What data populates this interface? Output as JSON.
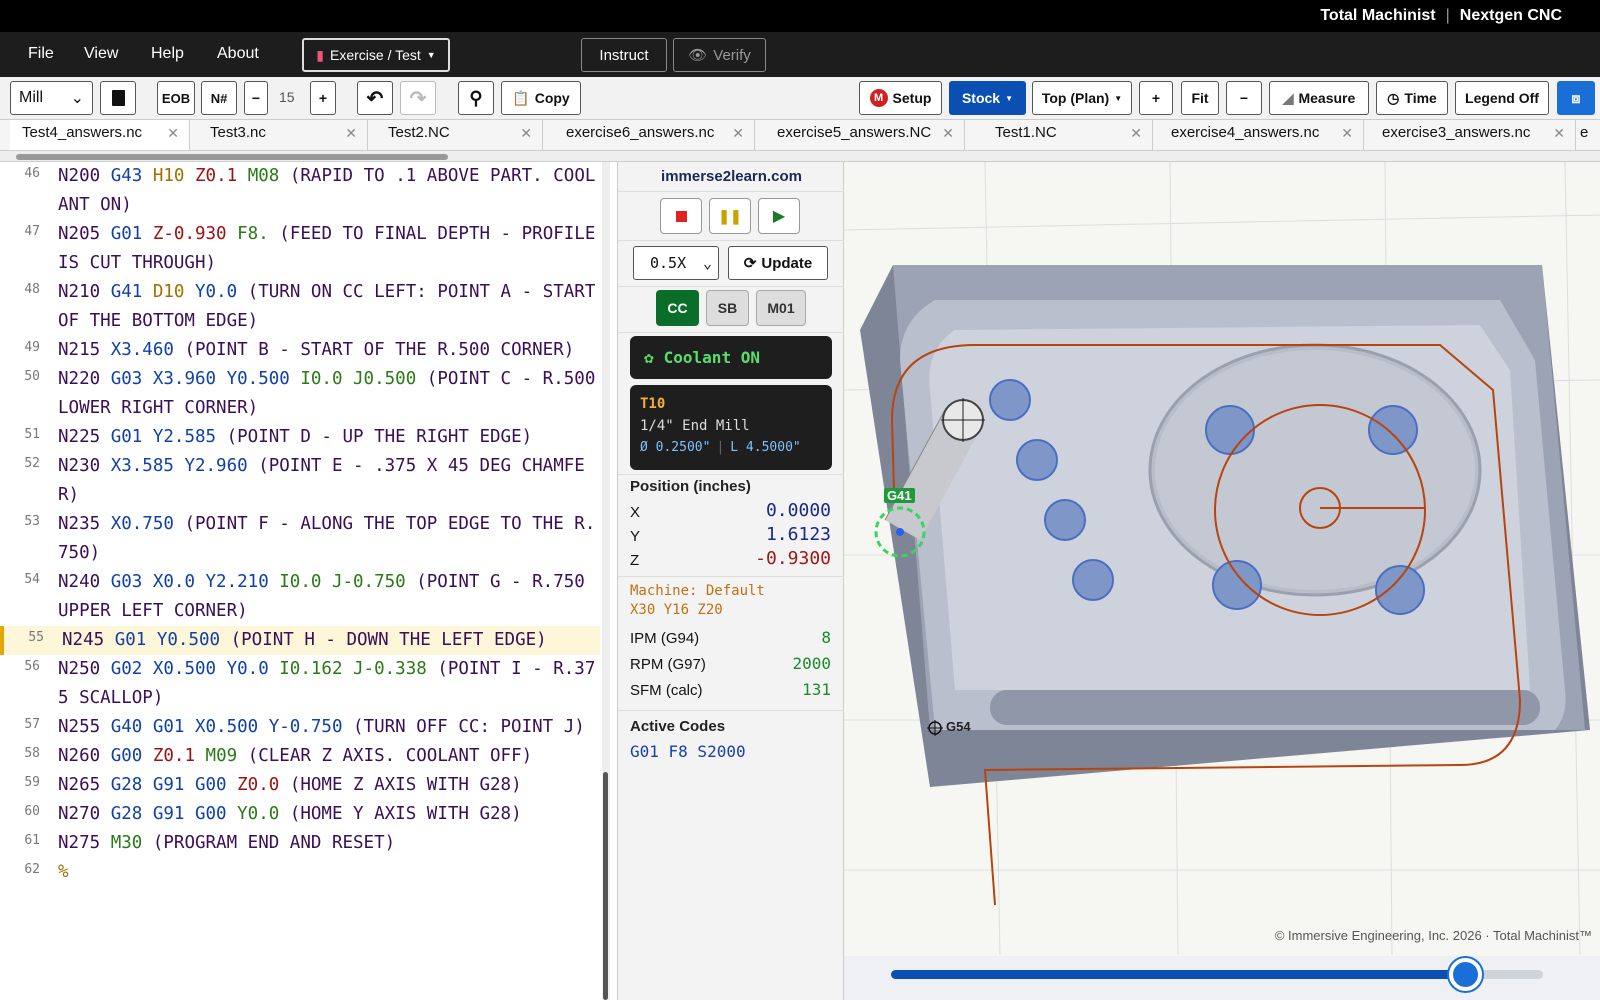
{
  "brand": {
    "left": "Total Machinist",
    "right": "Nextgen CNC"
  },
  "menu": {
    "file": "File",
    "view": "View",
    "help": "Help",
    "about": "About",
    "exercise": "Exercise / Test",
    "instruct": "Instruct",
    "verify": "Verify"
  },
  "toolbar": {
    "machine_type": "Mill",
    "eob": "EOB",
    "ncount": "N#",
    "minus": "−",
    "step": "15",
    "plus": "+",
    "copy": "Copy",
    "setup": "Setup",
    "stock": "Stock",
    "view": "Top (Plan)",
    "zoom_in": "+",
    "fit": "Fit",
    "zoom_out": "−",
    "measure": "Measure",
    "time": "Time",
    "legend": "Legend Off"
  },
  "tabs": [
    "Test4_answers.nc",
    "Test3.nc",
    "Test2.NC",
    "exercise6_answers.nc",
    "exercise5_answers.NC",
    "Test1.NC",
    "exercise4_answers.nc",
    "exercise3_answers.nc",
    "e"
  ],
  "code_lines": [
    {
      "n": "46",
      "segs": [
        [
          "n",
          "N200 "
        ],
        [
          "g",
          "G43 "
        ],
        [
          "t",
          "H10 "
        ],
        [
          "z",
          "Z0.1 "
        ],
        [
          "m",
          "M08 "
        ],
        [
          "n",
          "(RAPID TO .1 ABOVE PART. COOLANT ON)"
        ]
      ]
    },
    {
      "n": "47",
      "segs": [
        [
          "n",
          "N205 "
        ],
        [
          "g",
          "G01 "
        ],
        [
          "z",
          "Z-0.930 "
        ],
        [
          "m",
          "F8. "
        ],
        [
          "n",
          "(FEED TO FINAL DEPTH - PROFILE IS CUT THROUGH)"
        ]
      ]
    },
    {
      "n": "48",
      "segs": [
        [
          "n",
          "N210 "
        ],
        [
          "g",
          "G41 "
        ],
        [
          "t",
          "D10 "
        ],
        [
          "g",
          "Y0.0 "
        ],
        [
          "n",
          "(TURN ON CC LEFT: POINT A - START OF THE BOTTOM EDGE)"
        ]
      ]
    },
    {
      "n": "49",
      "segs": [
        [
          "n",
          "N215 "
        ],
        [
          "g",
          "X3.460 "
        ],
        [
          "n",
          "(POINT B - START OF THE R.500 CORNER)"
        ]
      ]
    },
    {
      "n": "50",
      "segs": [
        [
          "n",
          "N220 "
        ],
        [
          "g",
          "G03 X3.960 Y0.500 "
        ],
        [
          "m",
          "I0.0 J0.500 "
        ],
        [
          "n",
          "(POINT C - R.500 LOWER RIGHT CORNER)"
        ]
      ]
    },
    {
      "n": "51",
      "segs": [
        [
          "n",
          "N225 "
        ],
        [
          "g",
          "G01 Y2.585 "
        ],
        [
          "n",
          "(POINT D - UP THE RIGHT EDGE)"
        ]
      ]
    },
    {
      "n": "52",
      "segs": [
        [
          "n",
          "N230 "
        ],
        [
          "g",
          "X3.585 Y2.960 "
        ],
        [
          "n",
          "(POINT E - .375 X 45 DEG CHAMFER)"
        ]
      ]
    },
    {
      "n": "53",
      "segs": [
        [
          "n",
          "N235 "
        ],
        [
          "g",
          "X0.750 "
        ],
        [
          "n",
          "(POINT F - ALONG THE TOP EDGE TO THE R.750)"
        ]
      ]
    },
    {
      "n": "54",
      "segs": [
        [
          "n",
          "N240 "
        ],
        [
          "g",
          "G03 X0.0 Y2.210 "
        ],
        [
          "m",
          "I0.0 J-0.750 "
        ],
        [
          "n",
          "(POINT G - R.750 UPPER LEFT CORNER)"
        ]
      ]
    },
    {
      "n": "55",
      "segs": [
        [
          "n",
          "N245 "
        ],
        [
          "g",
          "G01 Y0.500 "
        ],
        [
          "n",
          "(POINT H - DOWN THE LEFT EDGE)"
        ]
      ]
    },
    {
      "n": "56",
      "segs": [
        [
          "n",
          "N250 "
        ],
        [
          "g",
          "G02 X0.500 Y0.0 "
        ],
        [
          "m",
          "I0.162 J-0.338 "
        ],
        [
          "n",
          "(POINT I - R.375 SCALLOP)"
        ]
      ]
    },
    {
      "n": "57",
      "segs": [
        [
          "n",
          "N255 "
        ],
        [
          "g",
          "G40 G01 X0.500 Y-0.750 "
        ],
        [
          "n",
          "(TURN OFF CC: POINT J)"
        ]
      ]
    },
    {
      "n": "58",
      "segs": [
        [
          "n",
          "N260 "
        ],
        [
          "g",
          "G00 "
        ],
        [
          "z",
          "Z0.1 "
        ],
        [
          "m",
          "M09 "
        ],
        [
          "n",
          "(CLEAR Z AXIS. COOLANT OFF)"
        ]
      ]
    },
    {
      "n": "59",
      "segs": [
        [
          "n",
          "N265 "
        ],
        [
          "g",
          "G28 G91 G00 "
        ],
        [
          "z",
          "Z0.0 "
        ],
        [
          "n",
          "(HOME Z AXIS WITH G28)"
        ]
      ]
    },
    {
      "n": "60",
      "segs": [
        [
          "n",
          "N270 "
        ],
        [
          "g",
          "G28 G91 G00 "
        ],
        [
          "m",
          "Y0.0 "
        ],
        [
          "n",
          "(HOME Y AXIS WITH G28)"
        ]
      ]
    },
    {
      "n": "61",
      "segs": [
        [
          "n",
          "N275 "
        ],
        [
          "m",
          "M30 "
        ],
        [
          "n",
          "(PROGRAM END AND RESET)"
        ]
      ]
    },
    {
      "n": "62",
      "segs": [
        [
          "t",
          "%"
        ]
      ]
    }
  ],
  "highlight_line": "55",
  "sim": {
    "site": "immerse2learn.com",
    "speed": "0.5X",
    "update": "Update",
    "cc": "CC",
    "sb": "SB",
    "m01": "M01",
    "coolant": "Coolant ON",
    "tool_id": "T10",
    "tool_name": "1/4\" End Mill",
    "tool_dia": "Ø 0.2500\"",
    "tool_len": "L 4.5000\"",
    "pos_title": "Position (inches)",
    "x_label": "X",
    "x_val": "0.0000",
    "y_label": "Y",
    "y_val": "1.6123",
    "z_label": "Z",
    "z_val": "-0.9300",
    "machine": "Machine: Default",
    "machine_dims": "X30 Y16 Z20",
    "ipm_label": "IPM (G94)",
    "ipm": "8",
    "rpm_label": "RPM (G97)",
    "rpm": "2000",
    "sfm_label": "SFM (calc)",
    "sfm": "131",
    "active_title": "Active Codes",
    "active_codes": "G01 F8 S2000"
  },
  "viewport": {
    "g41": "G41",
    "g54": "G54",
    "copyright": "© Immersive Engineering, Inc. 2026 · Total Machinist™",
    "progress": 0.88
  },
  "colors": {
    "accent": "#0b4fb3",
    "toolpath": "#b8440f",
    "cc_green": "#0a6e2a"
  }
}
